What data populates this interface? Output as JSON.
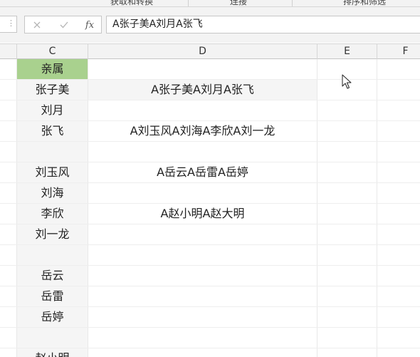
{
  "ribbon": {
    "groups": [
      "获取和转换",
      "连接",
      "排序和筛选"
    ]
  },
  "formula_bar": {
    "cancel_symbol": "✕",
    "enter_symbol": "✓",
    "fx_label": "fx",
    "value": "A张子美A刘月A张飞"
  },
  "columns": [
    "C",
    "D",
    "E",
    "F"
  ],
  "rows": [
    {
      "c": "亲属",
      "d": ""
    },
    {
      "c": "张子美",
      "d": "A张子美A刘月A张飞"
    },
    {
      "c": "刘月",
      "d": ""
    },
    {
      "c": "张飞",
      "d": "A刘玉风A刘海A李欣A刘一龙"
    },
    {
      "c": "",
      "d": ""
    },
    {
      "c": "刘玉风",
      "d": "A岳云A岳雷A岳婷"
    },
    {
      "c": "刘海",
      "d": ""
    },
    {
      "c": "李欣",
      "d": "A赵小明A赵大明"
    },
    {
      "c": "刘一龙",
      "d": ""
    },
    {
      "c": "",
      "d": ""
    },
    {
      "c": "岳云",
      "d": ""
    },
    {
      "c": "岳雷",
      "d": ""
    },
    {
      "c": "岳婷",
      "d": ""
    },
    {
      "c": "",
      "d": ""
    },
    {
      "c": "赵小明",
      "d": ""
    }
  ],
  "colors": {
    "header_fill": "#a9d18e",
    "selected_fill": "#f5f5f5"
  }
}
